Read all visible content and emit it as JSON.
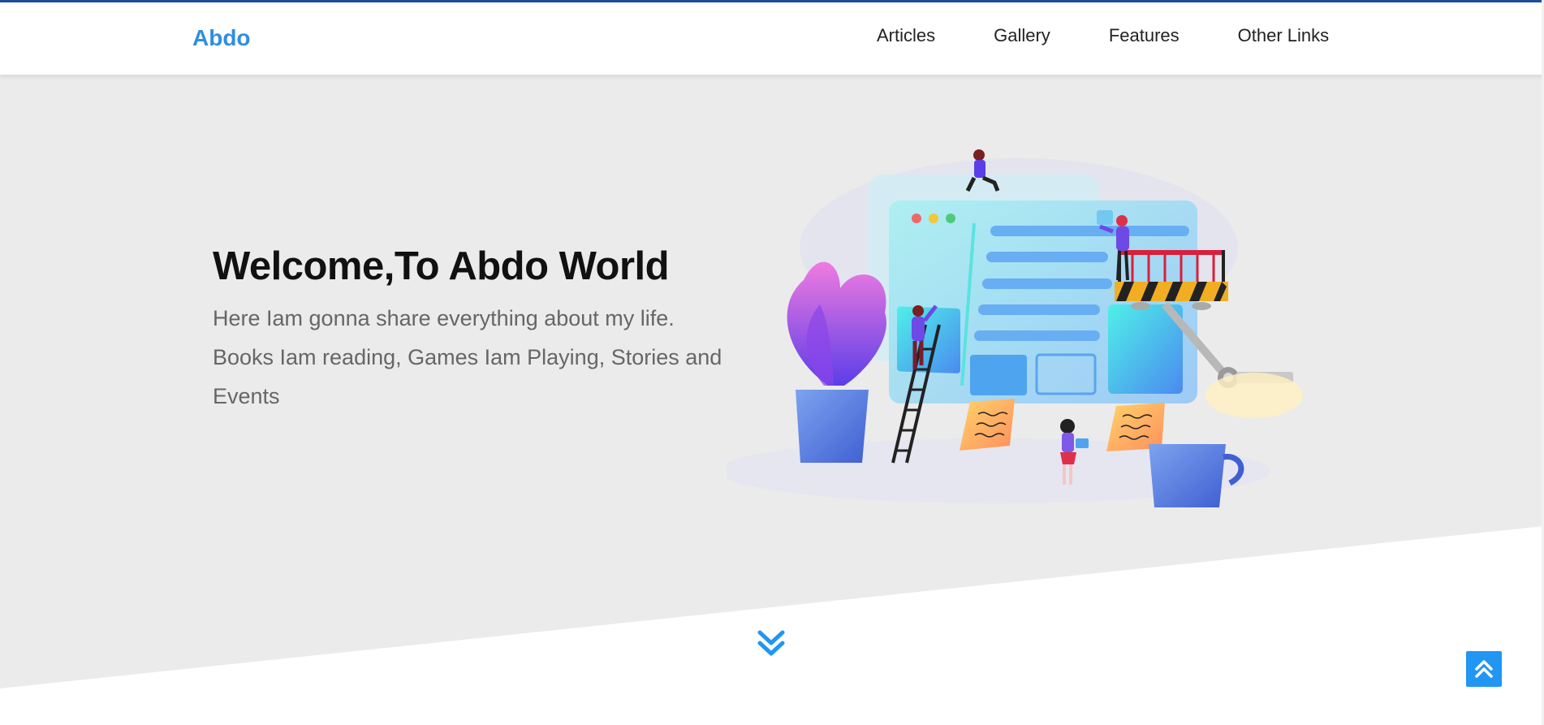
{
  "header": {
    "logo": "Abdo",
    "nav": [
      "Articles",
      "Gallery",
      "Features",
      "Other Links"
    ]
  },
  "landing": {
    "title": "Welcome,To Abdo World",
    "description": "Here Iam gonna share everything about my life. Books Iam reading, Games Iam Playing, Stories and Events"
  },
  "icons": {
    "down_arrow": "double-chevron-down-icon",
    "up_button": "double-chevron-up-icon"
  },
  "colors": {
    "brand": "#2f8ee0",
    "top_line": "#1f4e9b",
    "landing_bg": "#ebebeb",
    "up_button": "#2196f3"
  }
}
